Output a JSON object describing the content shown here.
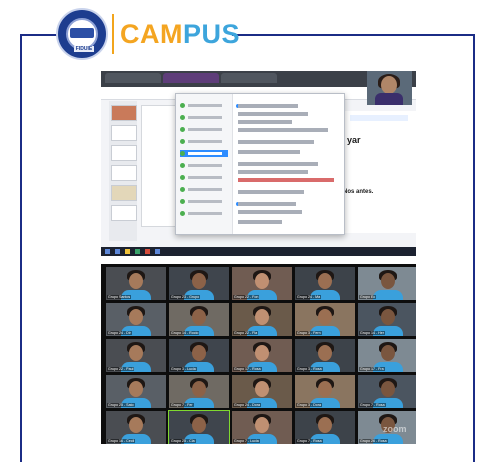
{
  "header": {
    "campus_part1": "CAM",
    "campus_part2": "PUS",
    "logo_seal_text": "FIDUIE"
  },
  "colors": {
    "frame": "#1b2c86",
    "campus_orange": "#f4a521",
    "campus_blue": "#3da5dc",
    "shirt_blue": "#3aa0dc"
  },
  "screenshot1": {
    "big_text_1": "yar",
    "big_text_2": "Nos antes."
  },
  "gallery": {
    "participants": [
      "Grupo Santos",
      "Grupo 23 - Grupo",
      "Grupo 22 - Fon",
      "Grupo 24 - Ma",
      "Grupo Ec",
      "Grupo 24 - Dir",
      "Grupo 14 - Rocio",
      "Grupo 22 - Fla",
      "Grupo 3 - Fern",
      "Grupo 14 - Her",
      "Grupo 22 - Paul",
      "Grupo 3 - Lucia",
      "Grupo 17 - Rosa",
      "Grupo 3 - Rosa",
      "Grupo 17 - Fra",
      "Grupo 25 - Sato",
      "Grupo 7 - Fer",
      "Grupo 24 - Dora",
      "Grupo 3 - Dora",
      "Grupo 7 - Rosa",
      "Grupo 16 - Cecil",
      "Grupo 25 - Cla",
      "Grupo 7 - Lucia",
      "Grupo 7 - Rosa",
      "Grupo 26 - Rosa"
    ],
    "watermark": "zoom"
  }
}
